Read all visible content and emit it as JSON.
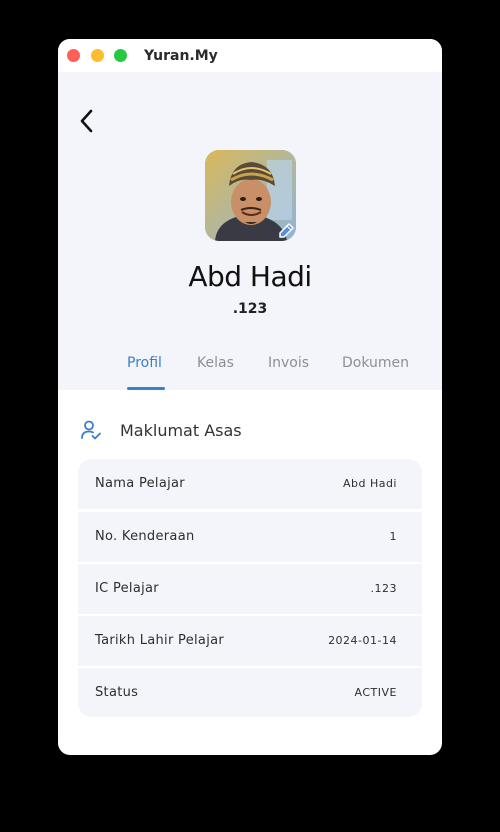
{
  "window": {
    "title": "Yuran.My"
  },
  "profile": {
    "name": "Abd Hadi",
    "id": ".123"
  },
  "tabs": [
    {
      "label": "Profil",
      "active": true
    },
    {
      "label": "Kelas",
      "active": false
    },
    {
      "label": "Invois",
      "active": false
    },
    {
      "label": "Dokumen",
      "active": false
    }
  ],
  "section": {
    "title": "Maklumat Asas",
    "icon": "user-check-icon"
  },
  "info_rows": [
    {
      "label": "Nama Pelajar",
      "value": "Abd Hadi"
    },
    {
      "label": "No. Kenderaan",
      "value": "1"
    },
    {
      "label": "IC Pelajar",
      "value": ".123"
    },
    {
      "label": "Tarikh Lahir Pelajar",
      "value": "2024-01-14"
    },
    {
      "label": "Status",
      "value": "ACTIVE"
    }
  ],
  "colors": {
    "accent": "#3b7ec9",
    "surface": "#f4f5fa",
    "close": "#ff5f57",
    "minimize": "#febc2e",
    "zoom": "#28c840"
  },
  "icons": {
    "back": "chevron-left-icon",
    "edit": "edit-photo-icon"
  }
}
